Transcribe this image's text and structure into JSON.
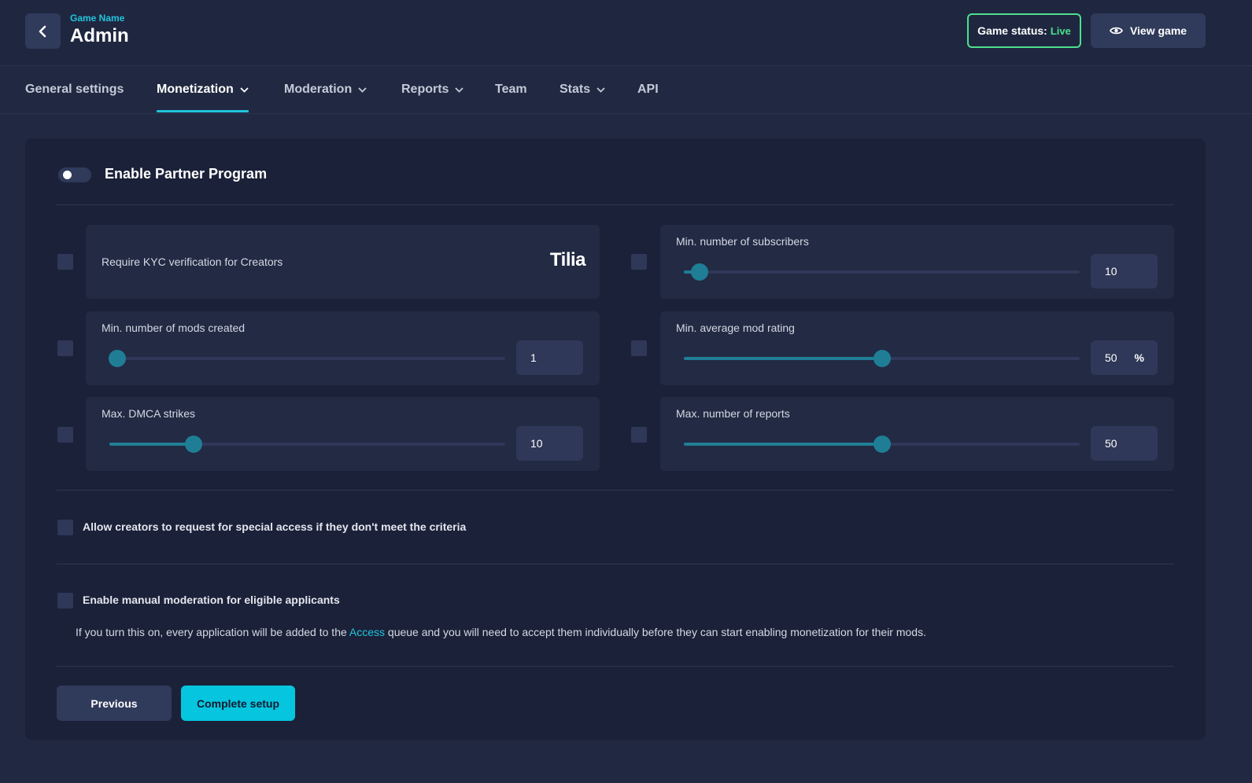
{
  "header": {
    "game_name": "Game Name",
    "title": "Admin",
    "status_label": "Game status:",
    "status_value": "Live",
    "view_game_label": "View game",
    "status_color": "#4ee08d"
  },
  "tabs": [
    {
      "label": "General settings",
      "has_dropdown": false,
      "active": false
    },
    {
      "label": "Monetization",
      "has_dropdown": true,
      "active": true
    },
    {
      "label": "Moderation",
      "has_dropdown": true,
      "active": false
    },
    {
      "label": "Reports",
      "has_dropdown": true,
      "active": false
    },
    {
      "label": "Team",
      "has_dropdown": false,
      "active": false
    },
    {
      "label": "Stats",
      "has_dropdown": true,
      "active": false
    },
    {
      "label": "API",
      "has_dropdown": false,
      "active": false
    }
  ],
  "partner_program": {
    "label": "Enable Partner Program",
    "enabled": false
  },
  "criteria": {
    "kyc": {
      "label": "Require KYC verification for Creators",
      "provider": "Tilia",
      "checked": false
    },
    "mods_created": {
      "label": "Min. number of mods created",
      "value": "1",
      "level": 0.0,
      "checked": false
    },
    "dmca_strikes": {
      "label": "Max. DMCA strikes",
      "value": "10",
      "level": 0.2,
      "checked": false
    },
    "subscribers": {
      "label": "Min. number of subscribers",
      "value": "10",
      "level": 0.02,
      "checked": false
    },
    "mod_rating": {
      "label": "Min. average mod rating",
      "value": "50",
      "unit": "%",
      "level": 0.5,
      "checked": false
    },
    "reports": {
      "label": "Max. number of reports",
      "value": "50",
      "level": 0.5,
      "checked": false
    }
  },
  "special_access": {
    "label": "Allow creators to request for special access if they don't meet the criteria",
    "checked": false
  },
  "manual_moderation": {
    "label": "Enable manual moderation for eligible applicants",
    "checked": false,
    "help_before": "If you turn this on, every application will be added to the ",
    "help_link": "Access",
    "help_after": " queue and you will need to accept them individually before they can start enabling monetization for their mods."
  },
  "actions": {
    "previous_label": "Previous",
    "complete_label": "Complete setup"
  },
  "colors": {
    "accent": "#21c4dc",
    "slider": "#1f7e95",
    "background": "#212942",
    "card": "#1b2138"
  }
}
